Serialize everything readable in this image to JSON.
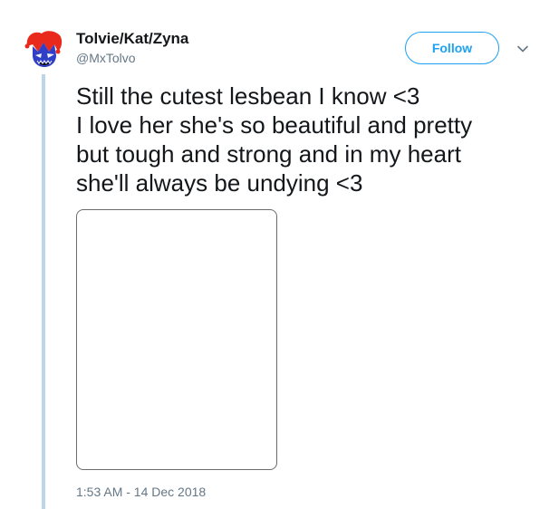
{
  "author": {
    "display_name": "Tolvie/Kat/Zyna",
    "handle": "@MxTolvo",
    "avatar_icon": "jester-avatar-icon"
  },
  "header": {
    "follow_label": "Follow",
    "menu_icon": "chevron-down-icon"
  },
  "tweet": {
    "text_lines": [
      "Still the cutest lesbean I know <3",
      "I love her she's so beautiful and pretty",
      "but tough and strong and in my heart",
      "she'll always be undying <3"
    ],
    "timestamp": "1:53 AM - 14 Dec 2018"
  },
  "colors": {
    "accent": "#1da1f2",
    "thread_line": "#bcd5e8",
    "secondary_text": "#657786",
    "primary_text": "#14171a"
  }
}
